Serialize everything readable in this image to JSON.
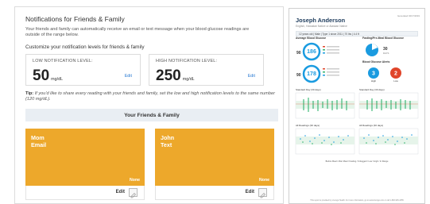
{
  "notifications": {
    "title": "Notifications for Friends & Family",
    "description": "Your friends and family can automatically receive an email or text message when your blood glucose readings are outside of the range below.",
    "customize_label": "Customize your notification levels for friends & family",
    "low": {
      "label": "LOW NOTIFICATION LEVEL:",
      "value": "50",
      "unit": "mg/dL",
      "edit": "Edit"
    },
    "high": {
      "label": "HIGH NOTIFICATION LEVEL:",
      "value": "250",
      "unit": "mg/dL",
      "edit": "Edit"
    },
    "tip_prefix": "Tip:",
    "tip_text": "If you'd like to share every reading with your friends and family, set the low and high notification levels to the same number (120 mg/dL).",
    "friends_heading": "Your Friends & Family",
    "friends": [
      {
        "name": "Mom",
        "method": "Email",
        "badge": "None",
        "edit": "Edit"
      },
      {
        "name": "John",
        "method": "Text",
        "badge": "None",
        "edit": "Edit"
      }
    ]
  },
  "report": {
    "patient_name": "Joseph Anderson",
    "patient_sub": "English, Hawaiian Native or Alaskan Native",
    "corner_text": "Generated 04/17/2019",
    "summary_bar": "12 years old | Male | Type 1 since 2011 | 70 lbs | 4.4 ft",
    "section_avg": "Average Blood Glucose",
    "section_fasting": "Fasting/Pre-Meal Blood Glucose",
    "section_alerts": "Blood Glucose Alerts",
    "avg_readings": [
      {
        "value": "186",
        "unit": "mg/dL",
        "color": "#1a9be0"
      },
      {
        "value": "178",
        "unit": "mg/dL",
        "color": "#1a9be0"
      }
    ],
    "small_values": [
      "90",
      "90"
    ],
    "alert_values": [
      {
        "value": "3",
        "color": "#1a9be0"
      },
      {
        "value": "2",
        "color": "#e0452a"
      }
    ],
    "alert_labels": [
      "High",
      "Low"
    ],
    "fasting_value": "30",
    "fasting_unit": "DAYS",
    "chart_titles": [
      "Standard Day (30 days)",
      "Standard Day (30 days)",
      "All Readings (30 days)",
      "All Readings (30 days)"
    ],
    "legend": "Before Meal / After Meal / Fasting / Unlogged / Low / High / In Range",
    "footer": "This report is provided by Livongo Health. For more information, go to www.livongo.com or call 1-800-945-4355"
  }
}
